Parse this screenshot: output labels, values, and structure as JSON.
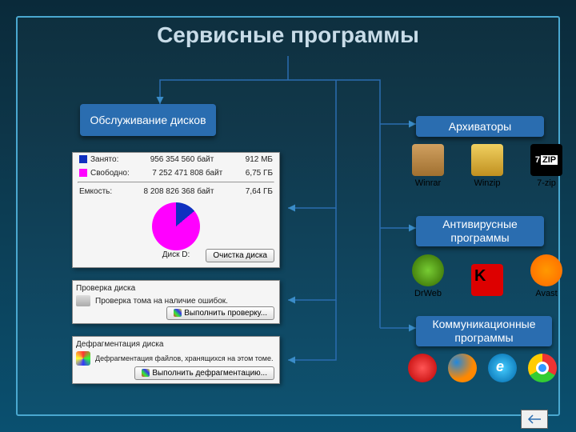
{
  "title": "Сервисные программы",
  "categories": {
    "disk": "Обслуживание дисков",
    "arch": "Архиваторы",
    "av": "Антивирусные программы",
    "comm": "Коммуникационные программы"
  },
  "disk_panel": {
    "used_lbl": "Занято:",
    "used_bytes": "956 354 560 байт",
    "used_h": "912 МБ",
    "free_lbl": "Свободно:",
    "free_bytes": "7 252 471 808 байт",
    "free_h": "6,75 ГБ",
    "cap_lbl": "Емкость:",
    "cap_bytes": "8 208 826 368 байт",
    "cap_h": "7,64 ГБ",
    "disk_name": "Диск D:",
    "cleanup_btn": "Очистка диска"
  },
  "check_panel": {
    "title": "Проверка диска",
    "desc": "Проверка тома на наличие ошибок.",
    "btn": "Выполнить проверку..."
  },
  "defrag_panel": {
    "title": "Дефрагментация диска",
    "desc": "Дефрагментация файлов, хранящихся на этом томе.",
    "btn": "Выполнить дефрагментацию..."
  },
  "archivers": [
    {
      "name": "Winrar"
    },
    {
      "name": "Winzip"
    },
    {
      "name": "7-zip"
    }
  ],
  "antivirus": [
    {
      "name": "DrWeb"
    },
    {
      "name": ""
    },
    {
      "name": "Avast"
    }
  ],
  "chart_data": {
    "type": "pie",
    "title": "Диск D:",
    "series": [
      {
        "name": "Занято",
        "value": 956354560,
        "human": "912 МБ",
        "color": "#1030c0"
      },
      {
        "name": "Свободно",
        "value": 7252471808,
        "human": "6,75 ГБ",
        "color": "#ff00ff"
      }
    ],
    "total": {
      "name": "Емкость",
      "value": 8208826368,
      "human": "7,64 ГБ"
    }
  }
}
